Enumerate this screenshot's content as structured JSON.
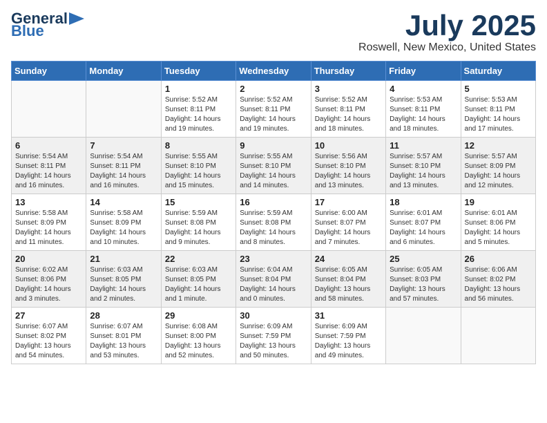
{
  "header": {
    "logo_line1": "General",
    "logo_line2": "Blue",
    "month": "July 2025",
    "location": "Roswell, New Mexico, United States"
  },
  "weekdays": [
    "Sunday",
    "Monday",
    "Tuesday",
    "Wednesday",
    "Thursday",
    "Friday",
    "Saturday"
  ],
  "weeks": [
    [
      {
        "day": "",
        "info": ""
      },
      {
        "day": "",
        "info": ""
      },
      {
        "day": "1",
        "info": "Sunrise: 5:52 AM\nSunset: 8:11 PM\nDaylight: 14 hours\nand 19 minutes."
      },
      {
        "day": "2",
        "info": "Sunrise: 5:52 AM\nSunset: 8:11 PM\nDaylight: 14 hours\nand 19 minutes."
      },
      {
        "day": "3",
        "info": "Sunrise: 5:52 AM\nSunset: 8:11 PM\nDaylight: 14 hours\nand 18 minutes."
      },
      {
        "day": "4",
        "info": "Sunrise: 5:53 AM\nSunset: 8:11 PM\nDaylight: 14 hours\nand 18 minutes."
      },
      {
        "day": "5",
        "info": "Sunrise: 5:53 AM\nSunset: 8:11 PM\nDaylight: 14 hours\nand 17 minutes."
      }
    ],
    [
      {
        "day": "6",
        "info": "Sunrise: 5:54 AM\nSunset: 8:11 PM\nDaylight: 14 hours\nand 16 minutes."
      },
      {
        "day": "7",
        "info": "Sunrise: 5:54 AM\nSunset: 8:11 PM\nDaylight: 14 hours\nand 16 minutes."
      },
      {
        "day": "8",
        "info": "Sunrise: 5:55 AM\nSunset: 8:10 PM\nDaylight: 14 hours\nand 15 minutes."
      },
      {
        "day": "9",
        "info": "Sunrise: 5:55 AM\nSunset: 8:10 PM\nDaylight: 14 hours\nand 14 minutes."
      },
      {
        "day": "10",
        "info": "Sunrise: 5:56 AM\nSunset: 8:10 PM\nDaylight: 14 hours\nand 13 minutes."
      },
      {
        "day": "11",
        "info": "Sunrise: 5:57 AM\nSunset: 8:10 PM\nDaylight: 14 hours\nand 13 minutes."
      },
      {
        "day": "12",
        "info": "Sunrise: 5:57 AM\nSunset: 8:09 PM\nDaylight: 14 hours\nand 12 minutes."
      }
    ],
    [
      {
        "day": "13",
        "info": "Sunrise: 5:58 AM\nSunset: 8:09 PM\nDaylight: 14 hours\nand 11 minutes."
      },
      {
        "day": "14",
        "info": "Sunrise: 5:58 AM\nSunset: 8:09 PM\nDaylight: 14 hours\nand 10 minutes."
      },
      {
        "day": "15",
        "info": "Sunrise: 5:59 AM\nSunset: 8:08 PM\nDaylight: 14 hours\nand 9 minutes."
      },
      {
        "day": "16",
        "info": "Sunrise: 5:59 AM\nSunset: 8:08 PM\nDaylight: 14 hours\nand 8 minutes."
      },
      {
        "day": "17",
        "info": "Sunrise: 6:00 AM\nSunset: 8:07 PM\nDaylight: 14 hours\nand 7 minutes."
      },
      {
        "day": "18",
        "info": "Sunrise: 6:01 AM\nSunset: 8:07 PM\nDaylight: 14 hours\nand 6 minutes."
      },
      {
        "day": "19",
        "info": "Sunrise: 6:01 AM\nSunset: 8:06 PM\nDaylight: 14 hours\nand 5 minutes."
      }
    ],
    [
      {
        "day": "20",
        "info": "Sunrise: 6:02 AM\nSunset: 8:06 PM\nDaylight: 14 hours\nand 3 minutes."
      },
      {
        "day": "21",
        "info": "Sunrise: 6:03 AM\nSunset: 8:05 PM\nDaylight: 14 hours\nand 2 minutes."
      },
      {
        "day": "22",
        "info": "Sunrise: 6:03 AM\nSunset: 8:05 PM\nDaylight: 14 hours\nand 1 minute."
      },
      {
        "day": "23",
        "info": "Sunrise: 6:04 AM\nSunset: 8:04 PM\nDaylight: 14 hours\nand 0 minutes."
      },
      {
        "day": "24",
        "info": "Sunrise: 6:05 AM\nSunset: 8:04 PM\nDaylight: 13 hours\nand 58 minutes."
      },
      {
        "day": "25",
        "info": "Sunrise: 6:05 AM\nSunset: 8:03 PM\nDaylight: 13 hours\nand 57 minutes."
      },
      {
        "day": "26",
        "info": "Sunrise: 6:06 AM\nSunset: 8:02 PM\nDaylight: 13 hours\nand 56 minutes."
      }
    ],
    [
      {
        "day": "27",
        "info": "Sunrise: 6:07 AM\nSunset: 8:02 PM\nDaylight: 13 hours\nand 54 minutes."
      },
      {
        "day": "28",
        "info": "Sunrise: 6:07 AM\nSunset: 8:01 PM\nDaylight: 13 hours\nand 53 minutes."
      },
      {
        "day": "29",
        "info": "Sunrise: 6:08 AM\nSunset: 8:00 PM\nDaylight: 13 hours\nand 52 minutes."
      },
      {
        "day": "30",
        "info": "Sunrise: 6:09 AM\nSunset: 7:59 PM\nDaylight: 13 hours\nand 50 minutes."
      },
      {
        "day": "31",
        "info": "Sunrise: 6:09 AM\nSunset: 7:59 PM\nDaylight: 13 hours\nand 49 minutes."
      },
      {
        "day": "",
        "info": ""
      },
      {
        "day": "",
        "info": ""
      }
    ]
  ]
}
